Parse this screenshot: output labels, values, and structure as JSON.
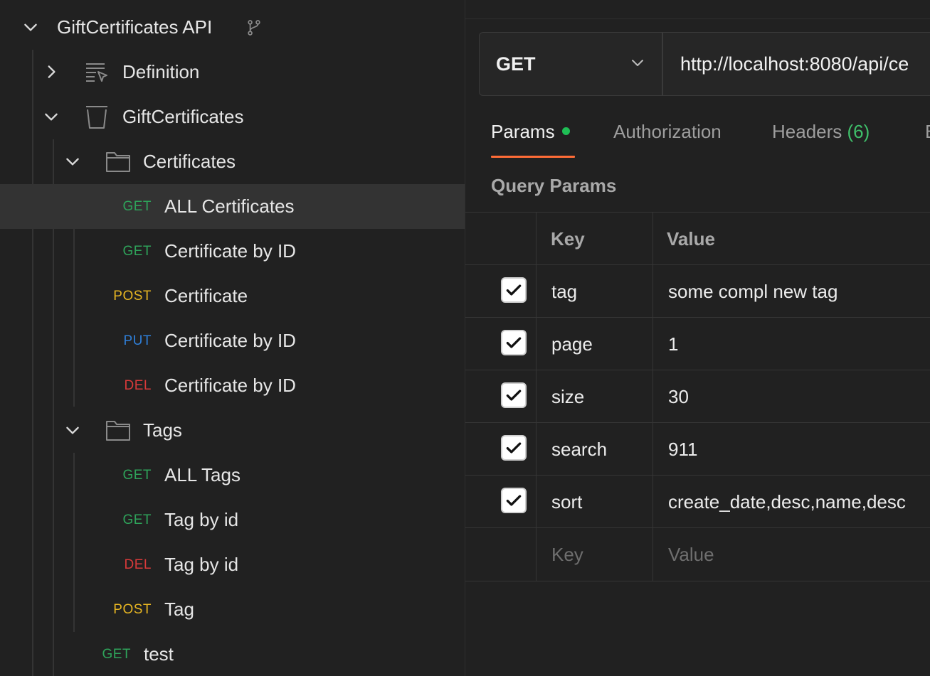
{
  "sidebar": {
    "collection": {
      "title": "GiftCertificates API"
    },
    "definition": {
      "label": "Definition"
    },
    "api": {
      "label": "GiftCertificates"
    },
    "folders": [
      {
        "label": "Certificates",
        "requests": [
          {
            "method": "GET",
            "name": "ALL Certificates"
          },
          {
            "method": "GET",
            "name": "Certificate by ID"
          },
          {
            "method": "POST",
            "name": "Certificate"
          },
          {
            "method": "PUT",
            "name": "Certificate by ID"
          },
          {
            "method": "DEL",
            "name": "Certificate by ID"
          }
        ]
      },
      {
        "label": "Tags",
        "requests": [
          {
            "method": "GET",
            "name": "ALL Tags"
          },
          {
            "method": "GET",
            "name": "Tag by id"
          },
          {
            "method": "DEL",
            "name": "Tag by id"
          },
          {
            "method": "POST",
            "name": "Tag"
          }
        ]
      }
    ],
    "root_request": {
      "method": "GET",
      "name": "test"
    }
  },
  "request": {
    "method": "GET",
    "url": "http://localhost:8080/api/ce"
  },
  "tabs": [
    {
      "label": "Params"
    },
    {
      "label": "Authorization"
    },
    {
      "label": "Headers",
      "count": "(6)"
    },
    {
      "label": "B"
    }
  ],
  "query_params": {
    "title": "Query Params",
    "headers": {
      "key": "Key",
      "value": "Value"
    },
    "rows": [
      {
        "key": "tag",
        "value": "some compl new tag",
        "checked": true
      },
      {
        "key": "page",
        "value": "1",
        "checked": true
      },
      {
        "key": "size",
        "value": "30",
        "checked": true
      },
      {
        "key": "search",
        "value": "911",
        "checked": true
      },
      {
        "key": "sort",
        "value": "create_date,desc,name,desc",
        "checked": true
      }
    ],
    "placeholder": {
      "key": "Key",
      "value": "Value"
    }
  },
  "colors": {
    "get": "#2ea35a",
    "post": "#e6b522",
    "put": "#2f7fd8",
    "del": "#d93a3a",
    "accent": "#ff6c37",
    "status_dot": "#1fbf55"
  }
}
